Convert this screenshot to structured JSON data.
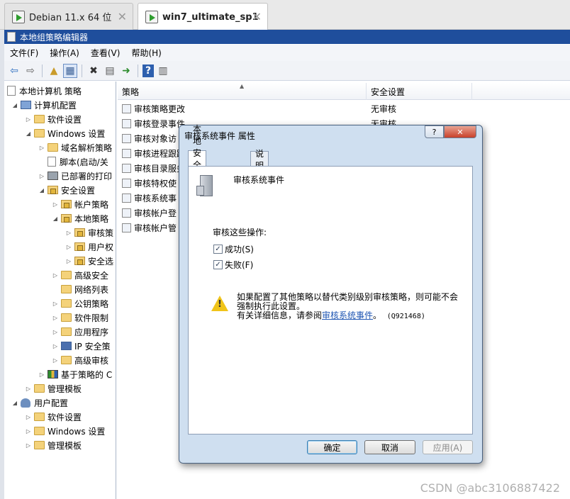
{
  "vm_tabs": [
    {
      "label": "Debian 11.x 64 位"
    },
    {
      "label": "win7_ultimate_sp1"
    }
  ],
  "app": {
    "title": "本地组策略编辑器"
  },
  "menu": [
    "文件(F)",
    "操作(A)",
    "查看(V)",
    "帮助(H)"
  ],
  "tree": [
    {
      "label": "本地计算机 策略"
    },
    {
      "label": "计算机配置"
    },
    {
      "label": "软件设置"
    },
    {
      "label": "Windows 设置"
    },
    {
      "label": "域名解析策略"
    },
    {
      "label": "脚本(启动/关"
    },
    {
      "label": "已部署的打印"
    },
    {
      "label": "安全设置"
    },
    {
      "label": "帐户策略"
    },
    {
      "label": "本地策略"
    },
    {
      "label": "审核策"
    },
    {
      "label": "用户权"
    },
    {
      "label": "安全选"
    },
    {
      "label": "高级安全"
    },
    {
      "label": "网络列表"
    },
    {
      "label": "公钥策略"
    },
    {
      "label": "软件限制"
    },
    {
      "label": "应用程序"
    },
    {
      "label": "IP 安全策"
    },
    {
      "label": "高级审核"
    },
    {
      "label": "基于策略的 C"
    },
    {
      "label": "管理模板"
    },
    {
      "label": "用户配置"
    },
    {
      "label": "软件设置"
    },
    {
      "label": "Windows 设置"
    },
    {
      "label": "管理模板"
    }
  ],
  "list": {
    "columns": [
      "策略",
      "安全设置"
    ],
    "rows": [
      {
        "name": "审核策略更改",
        "value": "无审核"
      },
      {
        "name": "审核登录事件",
        "value": "无审核"
      },
      {
        "name": "审核对象访",
        "value": ""
      },
      {
        "name": "审核进程跟踪",
        "value": ""
      },
      {
        "name": "审核目录服务",
        "value": ""
      },
      {
        "name": "审核特权使",
        "value": ""
      },
      {
        "name": "审核系统事",
        "value": ""
      },
      {
        "name": "审核帐户登",
        "value": ""
      },
      {
        "name": "审核帐户管",
        "value": ""
      }
    ]
  },
  "dialog": {
    "title": "审核系统事件 属性",
    "help_label": "?",
    "close_label": "✕",
    "tabs": [
      "本地安全设置",
      "说明"
    ],
    "policy_name": "审核系统事件",
    "audit_label": "审核这些操作:",
    "success": {
      "label": "成功(S)",
      "checked": true
    },
    "failure": {
      "label": "失败(F)",
      "checked": true
    },
    "warning_line1": "如果配置了其他策略以替代类别级别审核策略，则可能不会",
    "warning_line2": "强制执行此设置。",
    "warning_line3_prefix": "有关详细信息，请参阅",
    "warning_link": "审核系统事件",
    "warning_line3_suffix": "。",
    "kb": "(Q921468)",
    "ok": "确定",
    "cancel": "取消",
    "apply": "应用(A)"
  },
  "watermark": "CSDN @abc3106887422"
}
